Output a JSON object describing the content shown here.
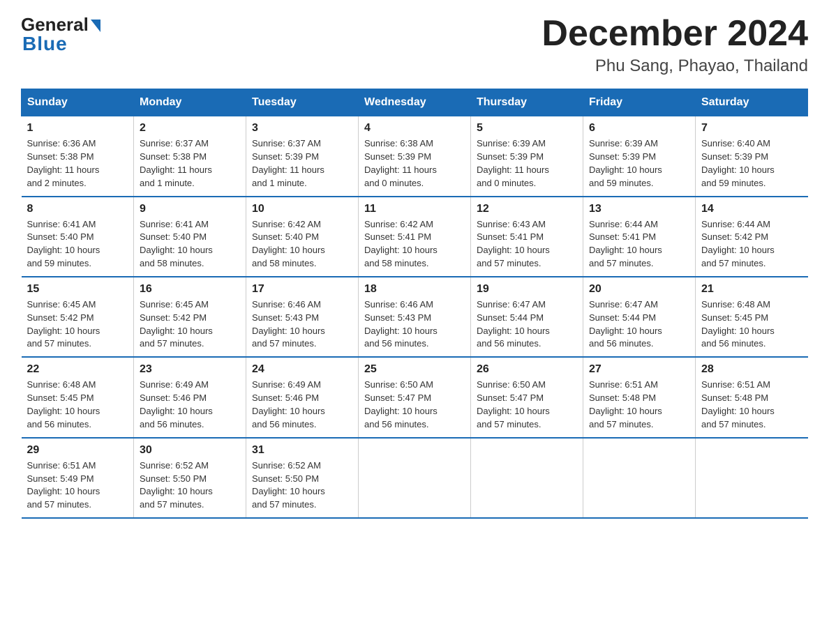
{
  "header": {
    "logo_text_general": "General",
    "logo_text_blue": "Blue",
    "month_year": "December 2024",
    "location": "Phu Sang, Phayao, Thailand"
  },
  "days_of_week": [
    "Sunday",
    "Monday",
    "Tuesday",
    "Wednesday",
    "Thursday",
    "Friday",
    "Saturday"
  ],
  "weeks": [
    [
      {
        "day": "1",
        "info": "Sunrise: 6:36 AM\nSunset: 5:38 PM\nDaylight: 11 hours\nand 2 minutes."
      },
      {
        "day": "2",
        "info": "Sunrise: 6:37 AM\nSunset: 5:38 PM\nDaylight: 11 hours\nand 1 minute."
      },
      {
        "day": "3",
        "info": "Sunrise: 6:37 AM\nSunset: 5:39 PM\nDaylight: 11 hours\nand 1 minute."
      },
      {
        "day": "4",
        "info": "Sunrise: 6:38 AM\nSunset: 5:39 PM\nDaylight: 11 hours\nand 0 minutes."
      },
      {
        "day": "5",
        "info": "Sunrise: 6:39 AM\nSunset: 5:39 PM\nDaylight: 11 hours\nand 0 minutes."
      },
      {
        "day": "6",
        "info": "Sunrise: 6:39 AM\nSunset: 5:39 PM\nDaylight: 10 hours\nand 59 minutes."
      },
      {
        "day": "7",
        "info": "Sunrise: 6:40 AM\nSunset: 5:39 PM\nDaylight: 10 hours\nand 59 minutes."
      }
    ],
    [
      {
        "day": "8",
        "info": "Sunrise: 6:41 AM\nSunset: 5:40 PM\nDaylight: 10 hours\nand 59 minutes."
      },
      {
        "day": "9",
        "info": "Sunrise: 6:41 AM\nSunset: 5:40 PM\nDaylight: 10 hours\nand 58 minutes."
      },
      {
        "day": "10",
        "info": "Sunrise: 6:42 AM\nSunset: 5:40 PM\nDaylight: 10 hours\nand 58 minutes."
      },
      {
        "day": "11",
        "info": "Sunrise: 6:42 AM\nSunset: 5:41 PM\nDaylight: 10 hours\nand 58 minutes."
      },
      {
        "day": "12",
        "info": "Sunrise: 6:43 AM\nSunset: 5:41 PM\nDaylight: 10 hours\nand 57 minutes."
      },
      {
        "day": "13",
        "info": "Sunrise: 6:44 AM\nSunset: 5:41 PM\nDaylight: 10 hours\nand 57 minutes."
      },
      {
        "day": "14",
        "info": "Sunrise: 6:44 AM\nSunset: 5:42 PM\nDaylight: 10 hours\nand 57 minutes."
      }
    ],
    [
      {
        "day": "15",
        "info": "Sunrise: 6:45 AM\nSunset: 5:42 PM\nDaylight: 10 hours\nand 57 minutes."
      },
      {
        "day": "16",
        "info": "Sunrise: 6:45 AM\nSunset: 5:42 PM\nDaylight: 10 hours\nand 57 minutes."
      },
      {
        "day": "17",
        "info": "Sunrise: 6:46 AM\nSunset: 5:43 PM\nDaylight: 10 hours\nand 57 minutes."
      },
      {
        "day": "18",
        "info": "Sunrise: 6:46 AM\nSunset: 5:43 PM\nDaylight: 10 hours\nand 56 minutes."
      },
      {
        "day": "19",
        "info": "Sunrise: 6:47 AM\nSunset: 5:44 PM\nDaylight: 10 hours\nand 56 minutes."
      },
      {
        "day": "20",
        "info": "Sunrise: 6:47 AM\nSunset: 5:44 PM\nDaylight: 10 hours\nand 56 minutes."
      },
      {
        "day": "21",
        "info": "Sunrise: 6:48 AM\nSunset: 5:45 PM\nDaylight: 10 hours\nand 56 minutes."
      }
    ],
    [
      {
        "day": "22",
        "info": "Sunrise: 6:48 AM\nSunset: 5:45 PM\nDaylight: 10 hours\nand 56 minutes."
      },
      {
        "day": "23",
        "info": "Sunrise: 6:49 AM\nSunset: 5:46 PM\nDaylight: 10 hours\nand 56 minutes."
      },
      {
        "day": "24",
        "info": "Sunrise: 6:49 AM\nSunset: 5:46 PM\nDaylight: 10 hours\nand 56 minutes."
      },
      {
        "day": "25",
        "info": "Sunrise: 6:50 AM\nSunset: 5:47 PM\nDaylight: 10 hours\nand 56 minutes."
      },
      {
        "day": "26",
        "info": "Sunrise: 6:50 AM\nSunset: 5:47 PM\nDaylight: 10 hours\nand 57 minutes."
      },
      {
        "day": "27",
        "info": "Sunrise: 6:51 AM\nSunset: 5:48 PM\nDaylight: 10 hours\nand 57 minutes."
      },
      {
        "day": "28",
        "info": "Sunrise: 6:51 AM\nSunset: 5:48 PM\nDaylight: 10 hours\nand 57 minutes."
      }
    ],
    [
      {
        "day": "29",
        "info": "Sunrise: 6:51 AM\nSunset: 5:49 PM\nDaylight: 10 hours\nand 57 minutes."
      },
      {
        "day": "30",
        "info": "Sunrise: 6:52 AM\nSunset: 5:50 PM\nDaylight: 10 hours\nand 57 minutes."
      },
      {
        "day": "31",
        "info": "Sunrise: 6:52 AM\nSunset: 5:50 PM\nDaylight: 10 hours\nand 57 minutes."
      },
      {
        "day": "",
        "info": ""
      },
      {
        "day": "",
        "info": ""
      },
      {
        "day": "",
        "info": ""
      },
      {
        "day": "",
        "info": ""
      }
    ]
  ]
}
